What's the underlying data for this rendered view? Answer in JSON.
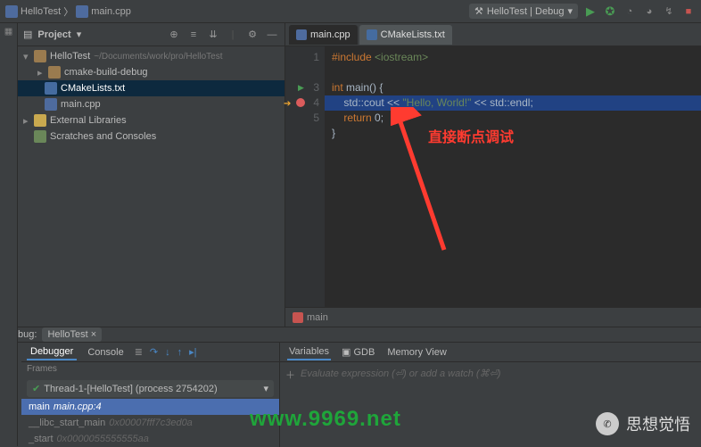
{
  "nav": {
    "breadcrumb1": "HelloTest",
    "breadcrumb2": "main.cpp"
  },
  "runconfig": {
    "label": "HelloTest | Debug"
  },
  "project": {
    "title": "Project",
    "root": "HelloTest",
    "rootPath": "~/Documents/work/pro/HelloTest",
    "items": {
      "buildDir": "cmake-build-debug",
      "cmakeFile": "CMakeLists.txt",
      "mainFile": "main.cpp"
    },
    "external": "External Libraries",
    "scratches": "Scratches and Consoles"
  },
  "editor": {
    "tabs": {
      "main": "main.cpp",
      "cmake": "CMakeLists.txt"
    },
    "crumb": "main",
    "lines": {
      "l1a": "#include",
      "l1b": "<iostream>",
      "l3a": "int ",
      "l3b": "main",
      "l3c": "() {",
      "l4a": "    std::",
      "l4b": "cout",
      "l4c": " << ",
      "l4d": "\"Hello, World!\"",
      "l4e": " << std::",
      "l4f": "endl",
      "l4g": ";",
      "l5a": "    ",
      "l5b": "return ",
      "l5c": "0;",
      "l6": "}",
      "n1": "1",
      "n3": "3",
      "n4": "4",
      "n5": "5"
    }
  },
  "annotation": {
    "text": "直接断点调试"
  },
  "debug": {
    "title": "Debug:",
    "tab": "HelloTest",
    "debuggerTab": "Debugger",
    "consoleTab": "Console",
    "framesTitle": "Frames",
    "thread": "Thread-1-[HelloTest] (process 2754202)",
    "frames": {
      "f0": "main",
      "f0src": "main.cpp:4",
      "f1": "__libc_start_main",
      "f1src": "0x00007fff7c3ed0a",
      "f2": "_start",
      "f2src": "0x0000055555555aa"
    },
    "varsTab": "Variables",
    "gdbTab": "GDB",
    "memTab": "Memory View",
    "watchPlaceholder": "Evaluate expression (⏎) or add a watch (⌘⏎)"
  },
  "watermark": {
    "url": "www.9969.net",
    "brand": "思想觉悟"
  }
}
